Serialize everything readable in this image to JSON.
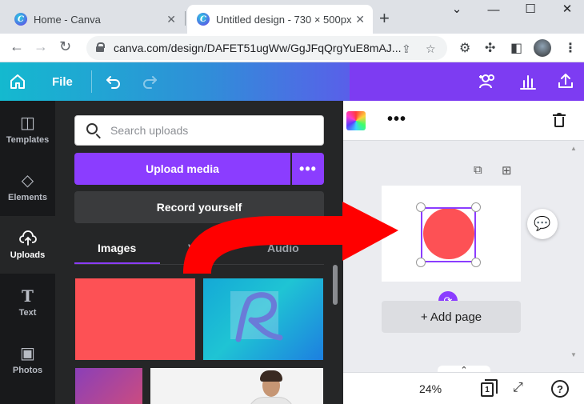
{
  "browser": {
    "tabs": [
      {
        "title": "Home - Canva",
        "active": false
      },
      {
        "title": "Untitled design - 730 × 500px",
        "active": true
      }
    ],
    "url": "canva.com/design/DAFET51ugWw/GgJFqQrgYuE8mAJ..."
  },
  "header": {
    "file_label": "File"
  },
  "rail": {
    "items": [
      {
        "label": "Templates",
        "icon": "templates-icon"
      },
      {
        "label": "Elements",
        "icon": "elements-icon"
      },
      {
        "label": "Uploads",
        "icon": "uploads-icon",
        "active": true
      },
      {
        "label": "Text",
        "icon": "text-icon"
      },
      {
        "label": "Photos",
        "icon": "photos-icon"
      }
    ]
  },
  "panel": {
    "search_placeholder": "Search uploads",
    "upload_label": "Upload media",
    "upload_more": "•••",
    "record_label": "Record yourself",
    "tabs": [
      {
        "label": "Images",
        "active": true
      },
      {
        "label": "Videos",
        "active": false
      },
      {
        "label": "Audio",
        "active": false
      }
    ]
  },
  "editor": {
    "more_dots": "•••",
    "add_page_label": "+ Add page",
    "zoom": "24%",
    "page_count": "1"
  },
  "colors": {
    "accent": "#8b3dff",
    "shape": "#fd5155",
    "arrow": "#ff0000"
  }
}
